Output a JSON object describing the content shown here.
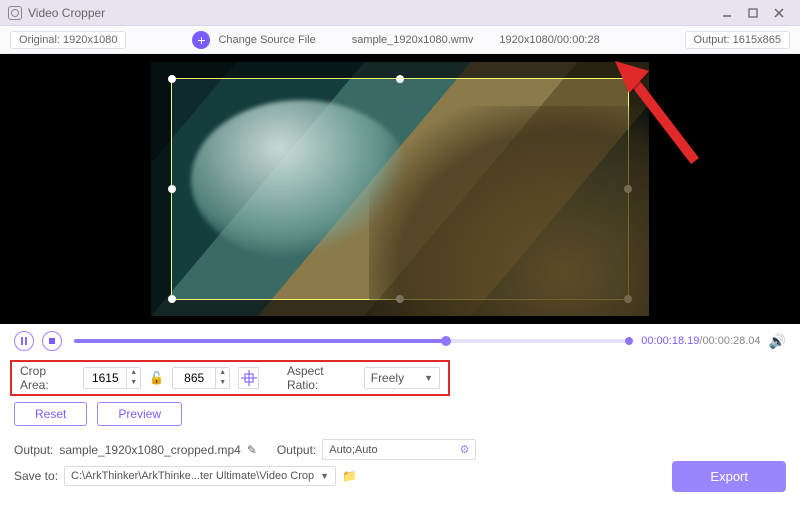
{
  "title": "Video Cropper",
  "toolbar": {
    "original_label": "Original:",
    "original_value": "1920x1080",
    "change_source": "Change Source File",
    "filename": "sample_1920x1080.wmv",
    "source_res_time": "1920x1080/00:00:28",
    "output_label": "Output:",
    "output_value": "1615x865"
  },
  "player": {
    "current": "00:00:18.19",
    "total": "00:00:28.04"
  },
  "crop": {
    "label": "Crop Area:",
    "width": "1615",
    "height": "865",
    "aspect_label": "Aspect Ratio:",
    "aspect_value": "Freely"
  },
  "buttons": {
    "reset": "Reset",
    "preview": "Preview",
    "export": "Export"
  },
  "output": {
    "label": "Output:",
    "filename": "sample_1920x1080_cropped.mp4",
    "label2": "Output:",
    "value2": "Auto;Auto"
  },
  "saveto": {
    "label": "Save to:",
    "path": "C:\\ArkThinker\\ArkThinke...ter Ultimate\\Video Crop"
  }
}
